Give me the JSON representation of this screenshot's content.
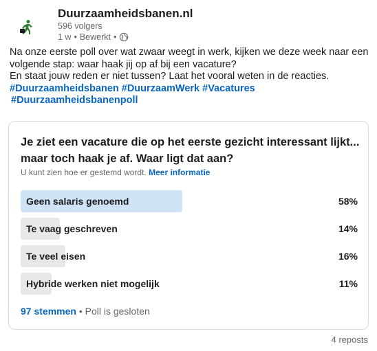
{
  "post": {
    "org_name": "Duurzaamheidsbanen.nl",
    "followers": "596 volgers",
    "age": "1 w",
    "separator": "•",
    "edited": "Bewerkt",
    "separator2": "•",
    "visibility_icon": "globe-icon",
    "body_lines": [
      "Na onze eerste poll over wat zwaar weegt in werk, kijken we deze week naar een",
      "volgende stap: waar haak jij op af bij een vacature?",
      "En staat jouw reden er niet tussen? Laat het vooral weten in de reacties."
    ],
    "hashtags_line1": "#Duurzaamheidsbanen #DuurzaamWerk #Vacatures",
    "hashtags_line2": "#Duurzaamheidsbanenpoll",
    "logo_icon": "runner-with-bag-icon",
    "brand_color": "#2e7d32"
  },
  "poll": {
    "question_lines": [
      "Je ziet een vacature die op het eerste gezicht interessant lijkt...",
      "maar toch haak je af. Waar ligt dat aan?"
    ],
    "visibility_text": "U kunt zien hoe er gestemd wordt.",
    "more_info": "Meer informatie",
    "options": [
      {
        "label": "Geen salaris genoemd",
        "percent": "58%",
        "share": 0.58,
        "top": true
      },
      {
        "label": "Te vaag geschreven",
        "percent": "14%",
        "share": 0.14,
        "top": false
      },
      {
        "label": "Te veel eisen",
        "percent": "16%",
        "share": 0.16,
        "top": false
      },
      {
        "label": "Hybride werken niet mogelijk",
        "percent": "11%",
        "share": 0.11,
        "top": false
      }
    ],
    "votes": "97 stemmen",
    "status_separator": "•",
    "status": "Poll is gesloten",
    "highlight_color": "#cfe3f7",
    "bar_color": "#e8e8e8",
    "link_color": "#0a66c2"
  },
  "reposts": "4 reposts"
}
